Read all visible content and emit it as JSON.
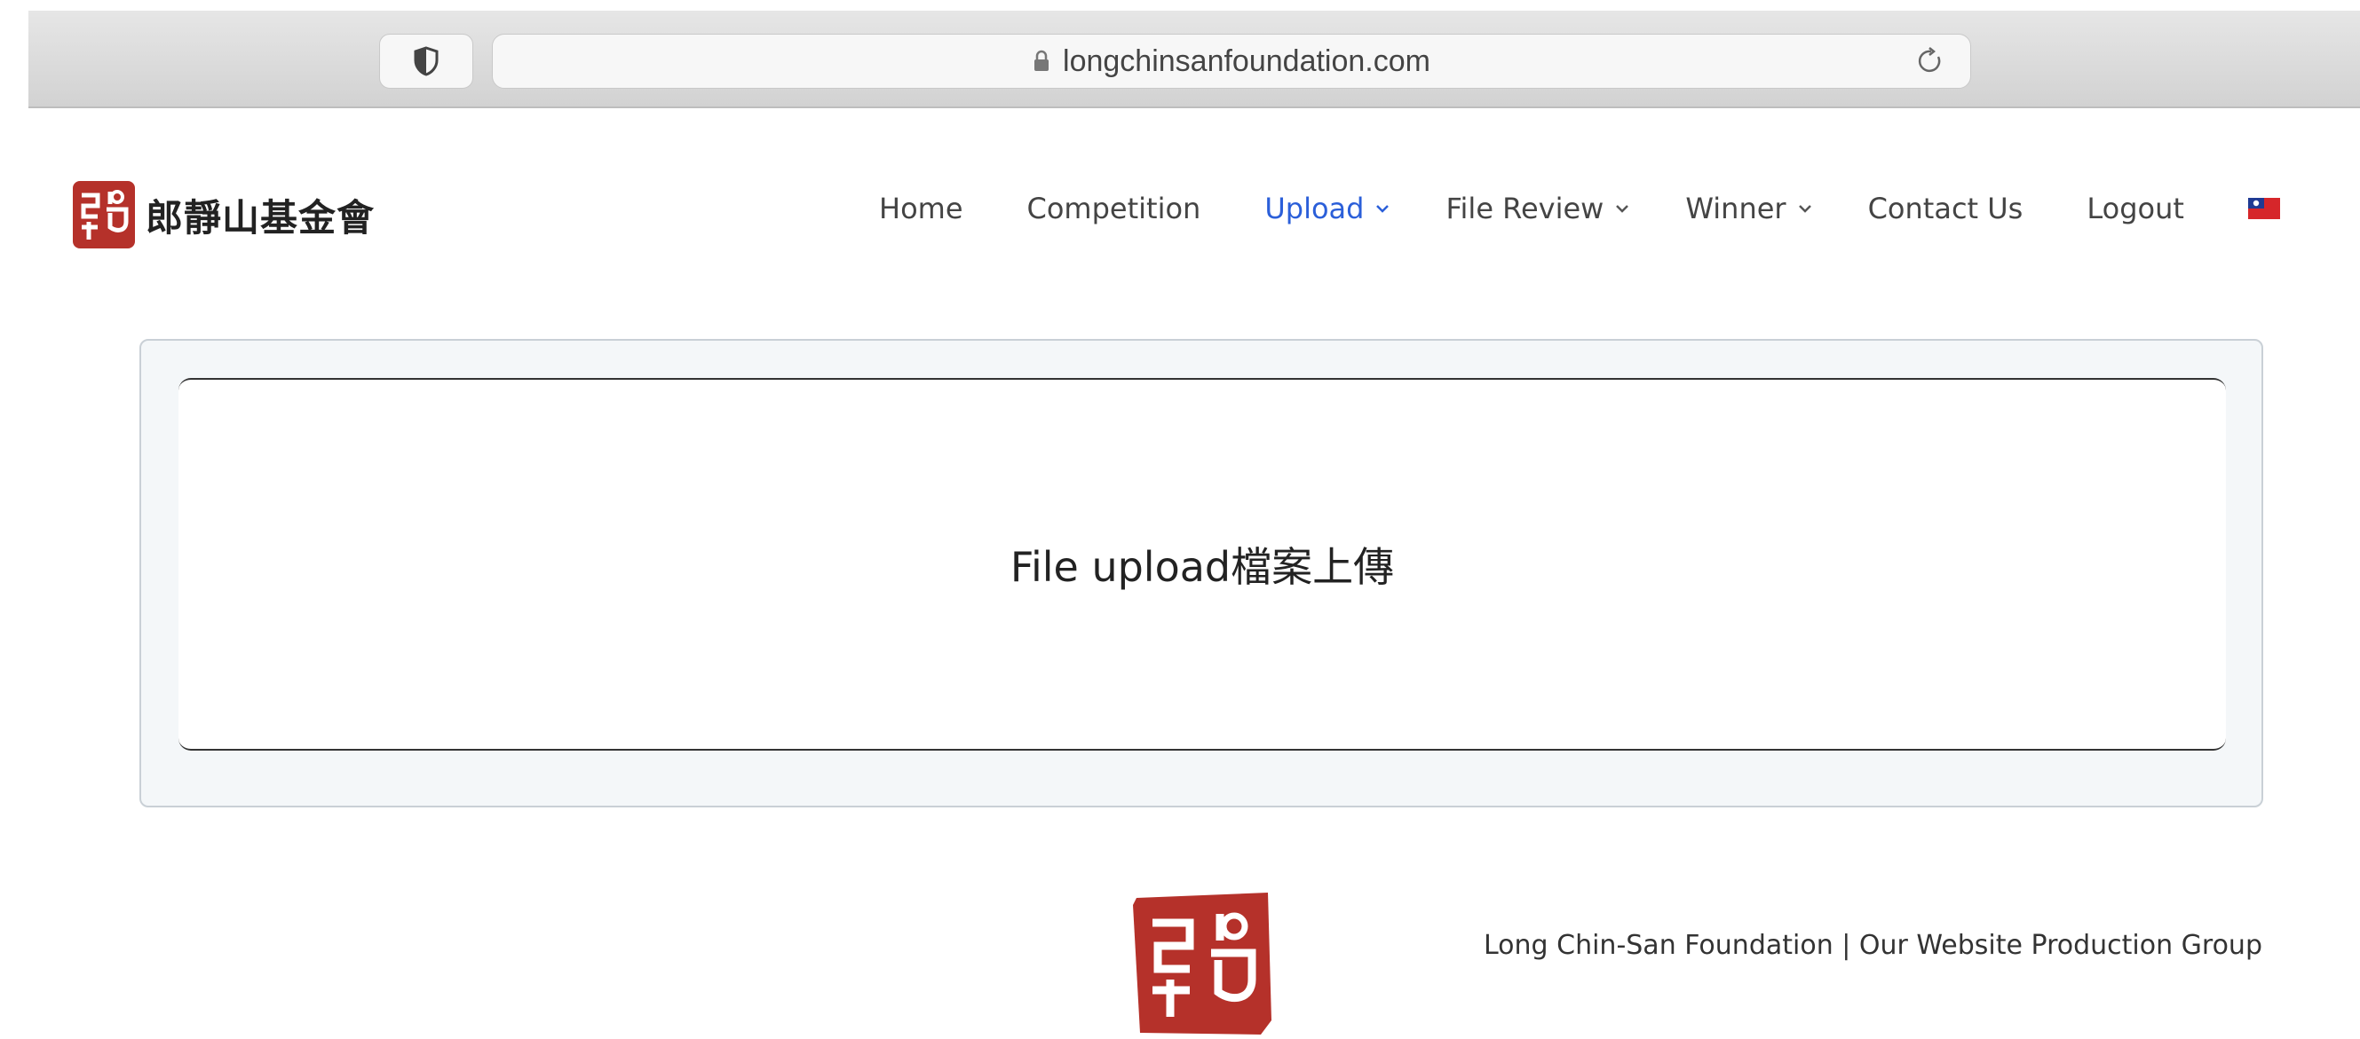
{
  "browser": {
    "url": "longchinsanfoundation.com"
  },
  "site": {
    "logo_text": "郎靜山基金會",
    "nav": [
      {
        "label": "Home",
        "has_dropdown": false,
        "active": false
      },
      {
        "label": "Competition",
        "has_dropdown": false,
        "active": false
      },
      {
        "label": "Upload",
        "has_dropdown": true,
        "active": true
      },
      {
        "label": "File Review",
        "has_dropdown": true,
        "active": false
      },
      {
        "label": "Winner",
        "has_dropdown": true,
        "active": false
      },
      {
        "label": "Contact Us",
        "has_dropdown": false,
        "active": false
      },
      {
        "label": "Logout",
        "has_dropdown": false,
        "active": false
      }
    ],
    "language_flag": "taiwan-flag-icon"
  },
  "main": {
    "title": "File upload檔案上傳"
  },
  "footer": {
    "credit": "Long Chin-San Foundation | Our Website Production Group"
  },
  "colors": {
    "accent": "#2b5fd9",
    "seal_red": "#b5312a"
  }
}
